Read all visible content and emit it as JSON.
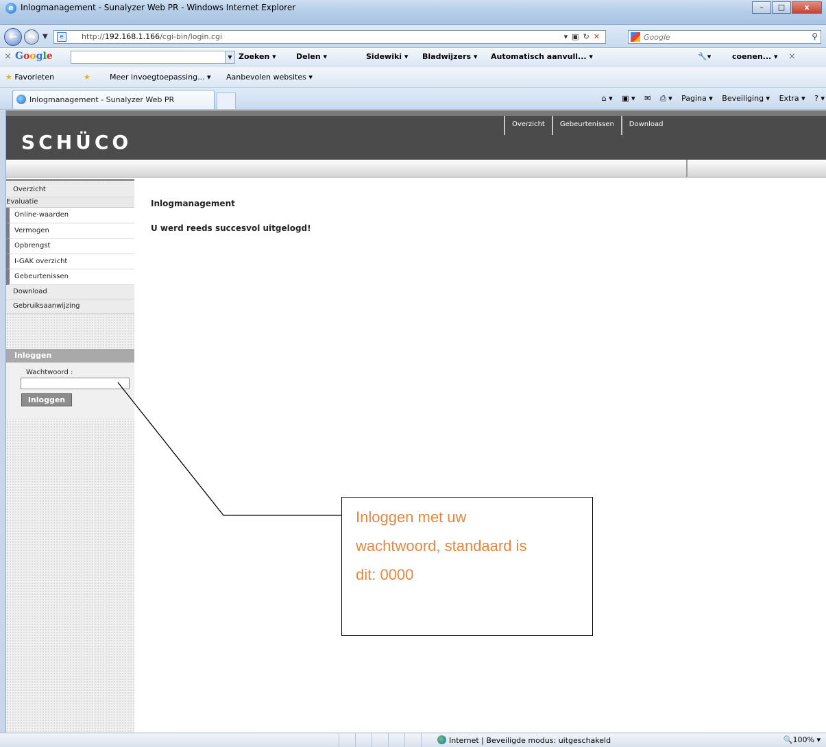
{
  "window": {
    "title": "Inlogmanagement - Sunalyzer Web PR - Windows Internet Explorer",
    "minimize": "–",
    "maximize": "□",
    "close": "x"
  },
  "address": {
    "url_prefix": "http://",
    "url_host": "192.168.1.166",
    "url_path": "/cgi-bin/login.cgi",
    "search_placeholder": "Google"
  },
  "google_toolbar": {
    "logo": "Google",
    "items": [
      "Zoeken ▾",
      "Delen ▾",
      "Sidewiki ▾",
      "Bladwijzers ▾",
      "Automatisch aanvull... ▾"
    ],
    "user": "coenen... ▾"
  },
  "favorites_bar": {
    "favorites": "Favorieten",
    "more_addons": "Meer invoegtoepassing... ▾",
    "suggested": "Aanbevolen websites ▾"
  },
  "tab": {
    "label": "Inlogmanagement - Sunalyzer Web PR"
  },
  "command_bar": {
    "page": "Pagina ▾",
    "safety": "Beveiliging ▾",
    "tools": "Extra ▾"
  },
  "site": {
    "logo": "SCHÜCO",
    "topnav": [
      "Overzicht",
      "Gebeurtenissen",
      "Download"
    ]
  },
  "sidebar": {
    "overview": "Overzicht",
    "section_evaluation": "Evaluatie",
    "sub_items": [
      "Online-waarden",
      "Vermogen",
      "Opbrengst",
      "I-GAK overzicht",
      "Gebeurtenissen"
    ],
    "download": "Download",
    "manual": "Gebruiksaanwijzing"
  },
  "login": {
    "heading": "Inloggen",
    "password_label": "Wachtwoord :",
    "password_value": "",
    "button": "Inloggen"
  },
  "content": {
    "title": "Inlogmanagement",
    "message": "U werd reeds succesvol uitgelogd!"
  },
  "annotation": {
    "text": "Inloggen met uw\nwachtwoord, standaard is\ndit:  0000"
  },
  "statusbar": {
    "zone": "Internet | Beveiligde modus: uitgeschakeld",
    "zoom": "100%"
  },
  "colors": {
    "header_bg": "#4b4b4b",
    "annotation_text": "#e8873f"
  }
}
